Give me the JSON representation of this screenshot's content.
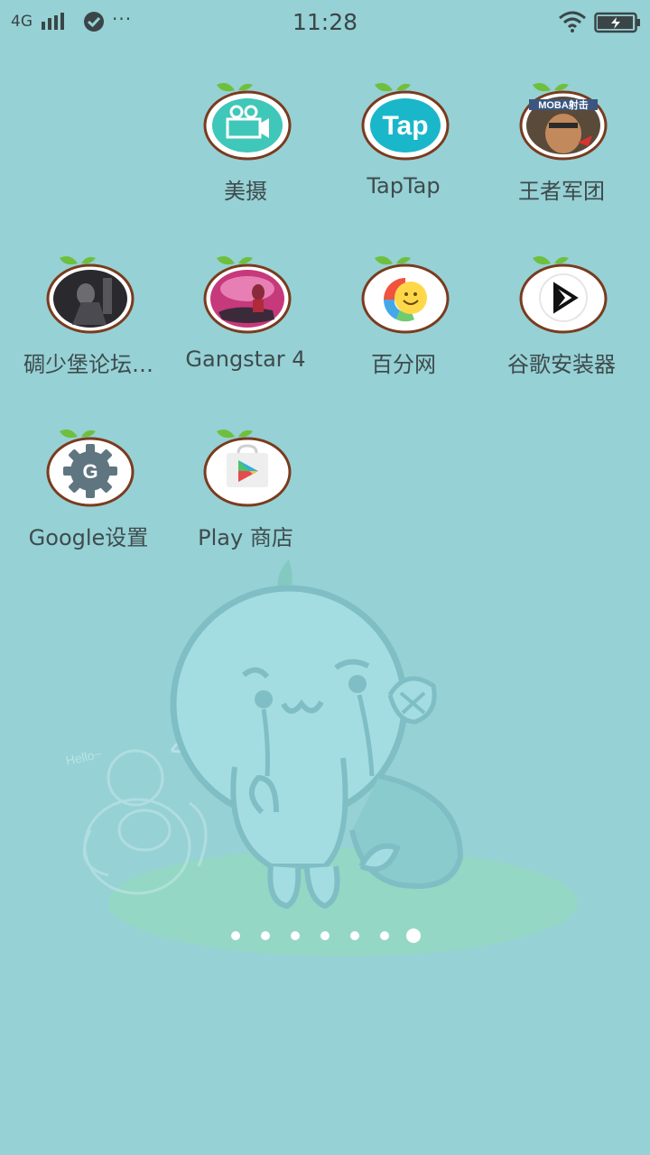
{
  "status_bar": {
    "network": "4G",
    "time": "11:28",
    "more": "···"
  },
  "apps": [
    {
      "label": "美摄",
      "icon": "video-camera-icon"
    },
    {
      "label": "TapTap",
      "icon": "taptap-icon",
      "icon_text": "Tap"
    },
    {
      "label": "王者军团",
      "icon": "game-hero-icon",
      "icon_text": "MOBA射击"
    },
    {
      "label": "碉少堡论坛…",
      "icon": "forum-photo-icon"
    },
    {
      "label": "Gangstar 4",
      "icon": "gangstar-icon"
    },
    {
      "label": "百分网",
      "icon": "smiley-icon"
    },
    {
      "label": "谷歌安装器",
      "icon": "play-triangle-icon"
    },
    {
      "label": "Google设置",
      "icon": "google-gear-icon",
      "icon_text": "G"
    },
    {
      "label": "Play 商店",
      "icon": "play-store-bag-icon"
    }
  ],
  "wallpaper": {
    "hello_text": "Hello~"
  },
  "pager": {
    "page_count": 7,
    "active_page": 7
  },
  "colors": {
    "background": "#96d1d5",
    "frame": "#7a3b1e",
    "leaf": "#6fbf3f"
  }
}
